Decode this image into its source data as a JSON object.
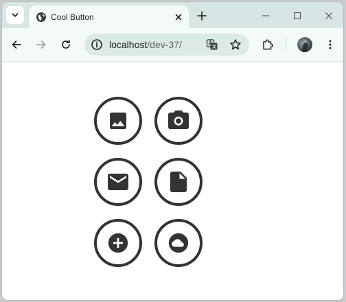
{
  "tab": {
    "title": "Cool Button"
  },
  "address_bar": {
    "host": "localhost",
    "path": "/dev-37/"
  },
  "colors": {
    "icon": "#333333",
    "tabstrip": "#d7e6e4",
    "toolbar": "#f4faf9",
    "omnibox": "#dbe9e7"
  },
  "buttons": [
    {
      "icon": "image-icon"
    },
    {
      "icon": "camera-icon"
    },
    {
      "icon": "mail-icon"
    },
    {
      "icon": "document-icon"
    },
    {
      "icon": "add-circle-icon"
    },
    {
      "icon": "cloud-icon"
    }
  ]
}
